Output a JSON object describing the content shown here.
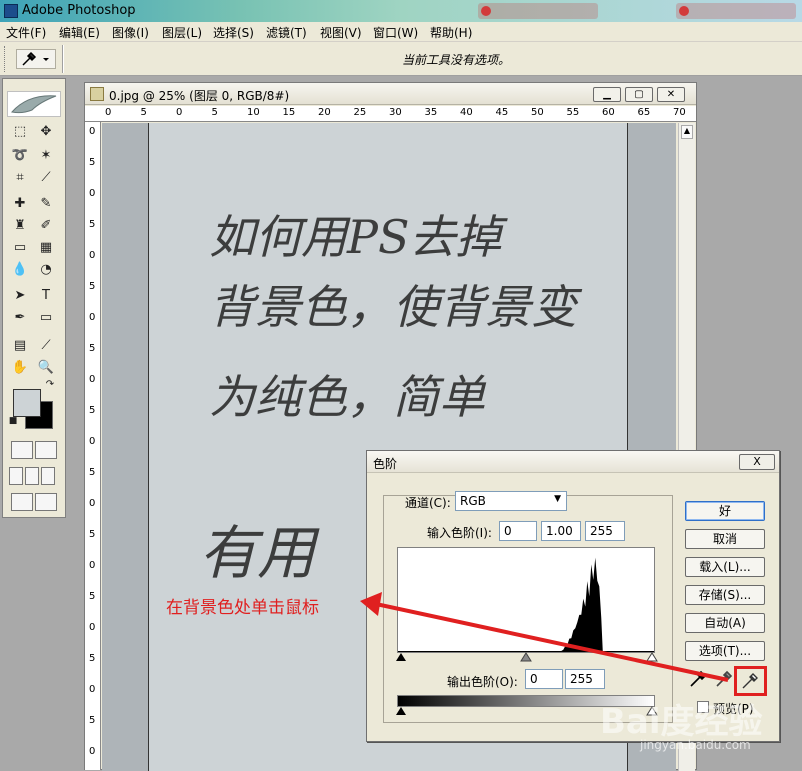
{
  "app": {
    "title": "Adobe Photoshop"
  },
  "menu": [
    "文件(F)",
    "编辑(E)",
    "图像(I)",
    "图层(L)",
    "选择(S)",
    "滤镜(T)",
    "视图(V)",
    "窗口(W)",
    "帮助(H)"
  ],
  "options_bar": {
    "message": "当前工具没有选项。"
  },
  "document": {
    "title": "0.jpg @ 25% (图层 0, RGB/8#)",
    "ruler_h": [
      "0",
      "5",
      "0",
      "5",
      "10",
      "15",
      "20",
      "25",
      "30",
      "35",
      "40",
      "45",
      "50",
      "55",
      "60",
      "65",
      "70"
    ],
    "ruler_v": [
      "0",
      "5",
      "0",
      "5",
      "0",
      "5",
      "0",
      "5",
      "0",
      "5",
      "0",
      "5",
      "0",
      "5",
      "0",
      "5",
      "0",
      "5",
      "0",
      "5",
      "0"
    ],
    "handwriting": [
      "如何用PS去掉",
      "背景色，使背景变",
      "为纯色，简单",
      "有用"
    ]
  },
  "levels_dialog": {
    "title": "色阶",
    "close": "X",
    "channel_label": "通道(C):",
    "channel_value": "RGB",
    "input_label": "输入色阶(I):",
    "input_values": [
      "0",
      "1.00",
      "255"
    ],
    "output_label": "输出色阶(O):",
    "output_values": [
      "0",
      "255"
    ],
    "buttons": [
      "好",
      "取消",
      "载入(L)...",
      "存储(S)...",
      "自动(A)",
      "选项(T)..."
    ],
    "preview_label": "预览(P)",
    "histogram": {
      "peak_start": 0.63,
      "peak_end": 0.8
    }
  },
  "annotation": "在背景色处单击鼠标",
  "watermark": {
    "brand": "Bai度经验",
    "url": "jingyan.baidu.com"
  },
  "colors": {
    "annotation": "#e02020",
    "foreground": "#cdd3d6",
    "background": "#000000"
  }
}
